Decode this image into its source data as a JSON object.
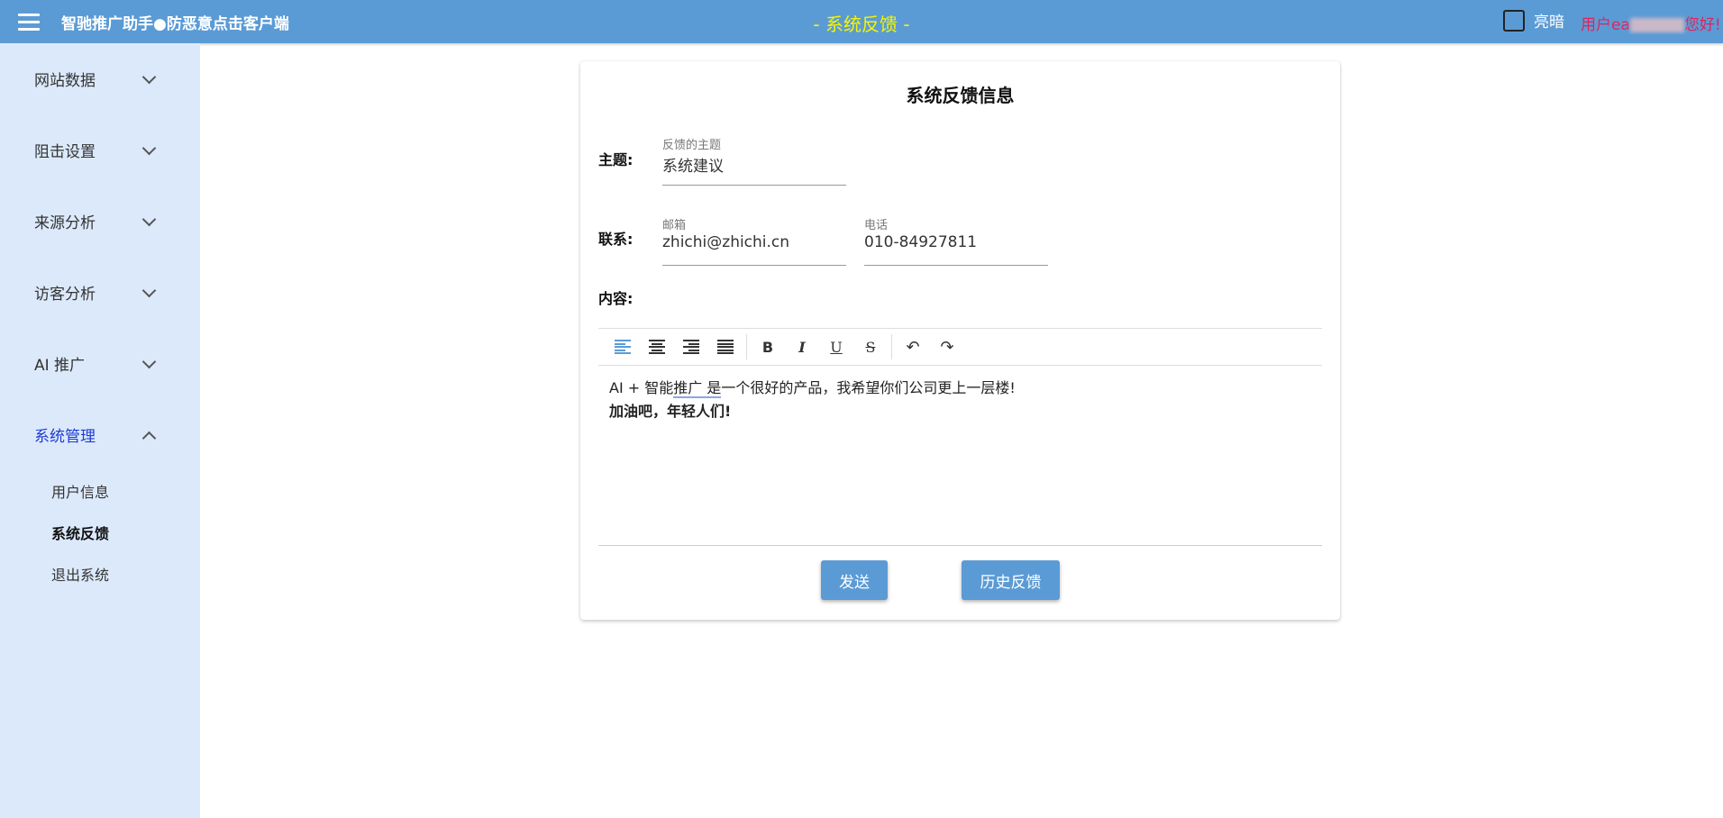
{
  "header": {
    "app_title": "智驰推广助手●防恶意点击客户端",
    "page_title": "- 系统反馈 -",
    "theme_label": "亮暗",
    "user_greeting_prefix": "用户ea",
    "user_greeting_suffix": "您好!"
  },
  "sidebar": {
    "groups": [
      {
        "label": "网站数据"
      },
      {
        "label": "阻击设置"
      },
      {
        "label": "来源分析"
      },
      {
        "label": "访客分析"
      },
      {
        "label": "AI 推广"
      },
      {
        "label": "系统管理"
      }
    ],
    "sub_items": [
      {
        "label": "用户信息"
      },
      {
        "label": "系统反馈"
      },
      {
        "label": "退出系统"
      }
    ]
  },
  "form": {
    "title": "系统反馈信息",
    "subject_label": "主题:",
    "subject_field_label": "反馈的主题",
    "subject_value": "系统建议",
    "contact_label": "联系:",
    "email_field_label": "邮箱",
    "email_value": "zhichi@zhichi.cn",
    "phone_field_label": "电话",
    "phone_value": "010-84927811",
    "content_label": "内容:",
    "content_line1_a": "AI + 智能",
    "content_line1_b": "推广 是",
    "content_line1_c": "一个很好的产品，我希望你们公司更上一层楼!",
    "content_line2": "加油吧，年轻人们!",
    "send_button": "发送",
    "history_button": "历史反馈"
  },
  "toolbar": {
    "bold": "B",
    "italic": "I",
    "underline": "U",
    "strike": "S",
    "undo": "↶",
    "redo": "↷"
  },
  "colors": {
    "header_bg": "#5b9bd5",
    "page_title": "#f5f500",
    "sidebar_bg": "#dce9fb",
    "active_nav": "#1e3cd2",
    "greeting": "#e0245e"
  }
}
